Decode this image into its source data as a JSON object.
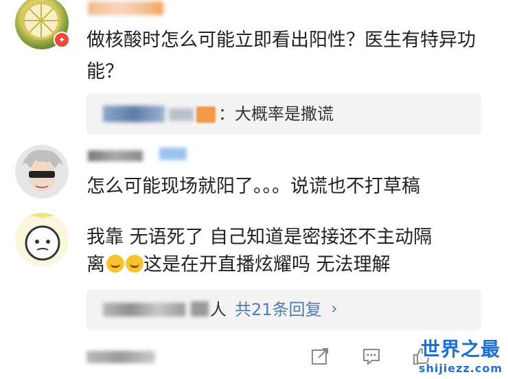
{
  "comments": [
    {
      "text": "做核酸时怎么可能立即看出阳性？医生有特异功能？",
      "reply": {
        "text": "：大概率是撒谎"
      }
    },
    {
      "text": "怎么可能现场就阳了。。。说谎也不打草稿"
    },
    {
      "text_line1": "我靠 无语死了 自己知道是密接还不主动隔",
      "text_line2_prefix": "离",
      "text_line2_suffix": "这是在开直播炫耀吗 无法理解",
      "replies_link": {
        "suffix": "人",
        "label": "共21条回复",
        "chevron": "›"
      }
    }
  ],
  "footer": {
    "icons": [
      "share-icon",
      "comment-icon",
      "like-icon"
    ]
  },
  "watermark": {
    "main": "世界之最",
    "sub": "shijiezz.com",
    "color": "#1d6fd6"
  }
}
